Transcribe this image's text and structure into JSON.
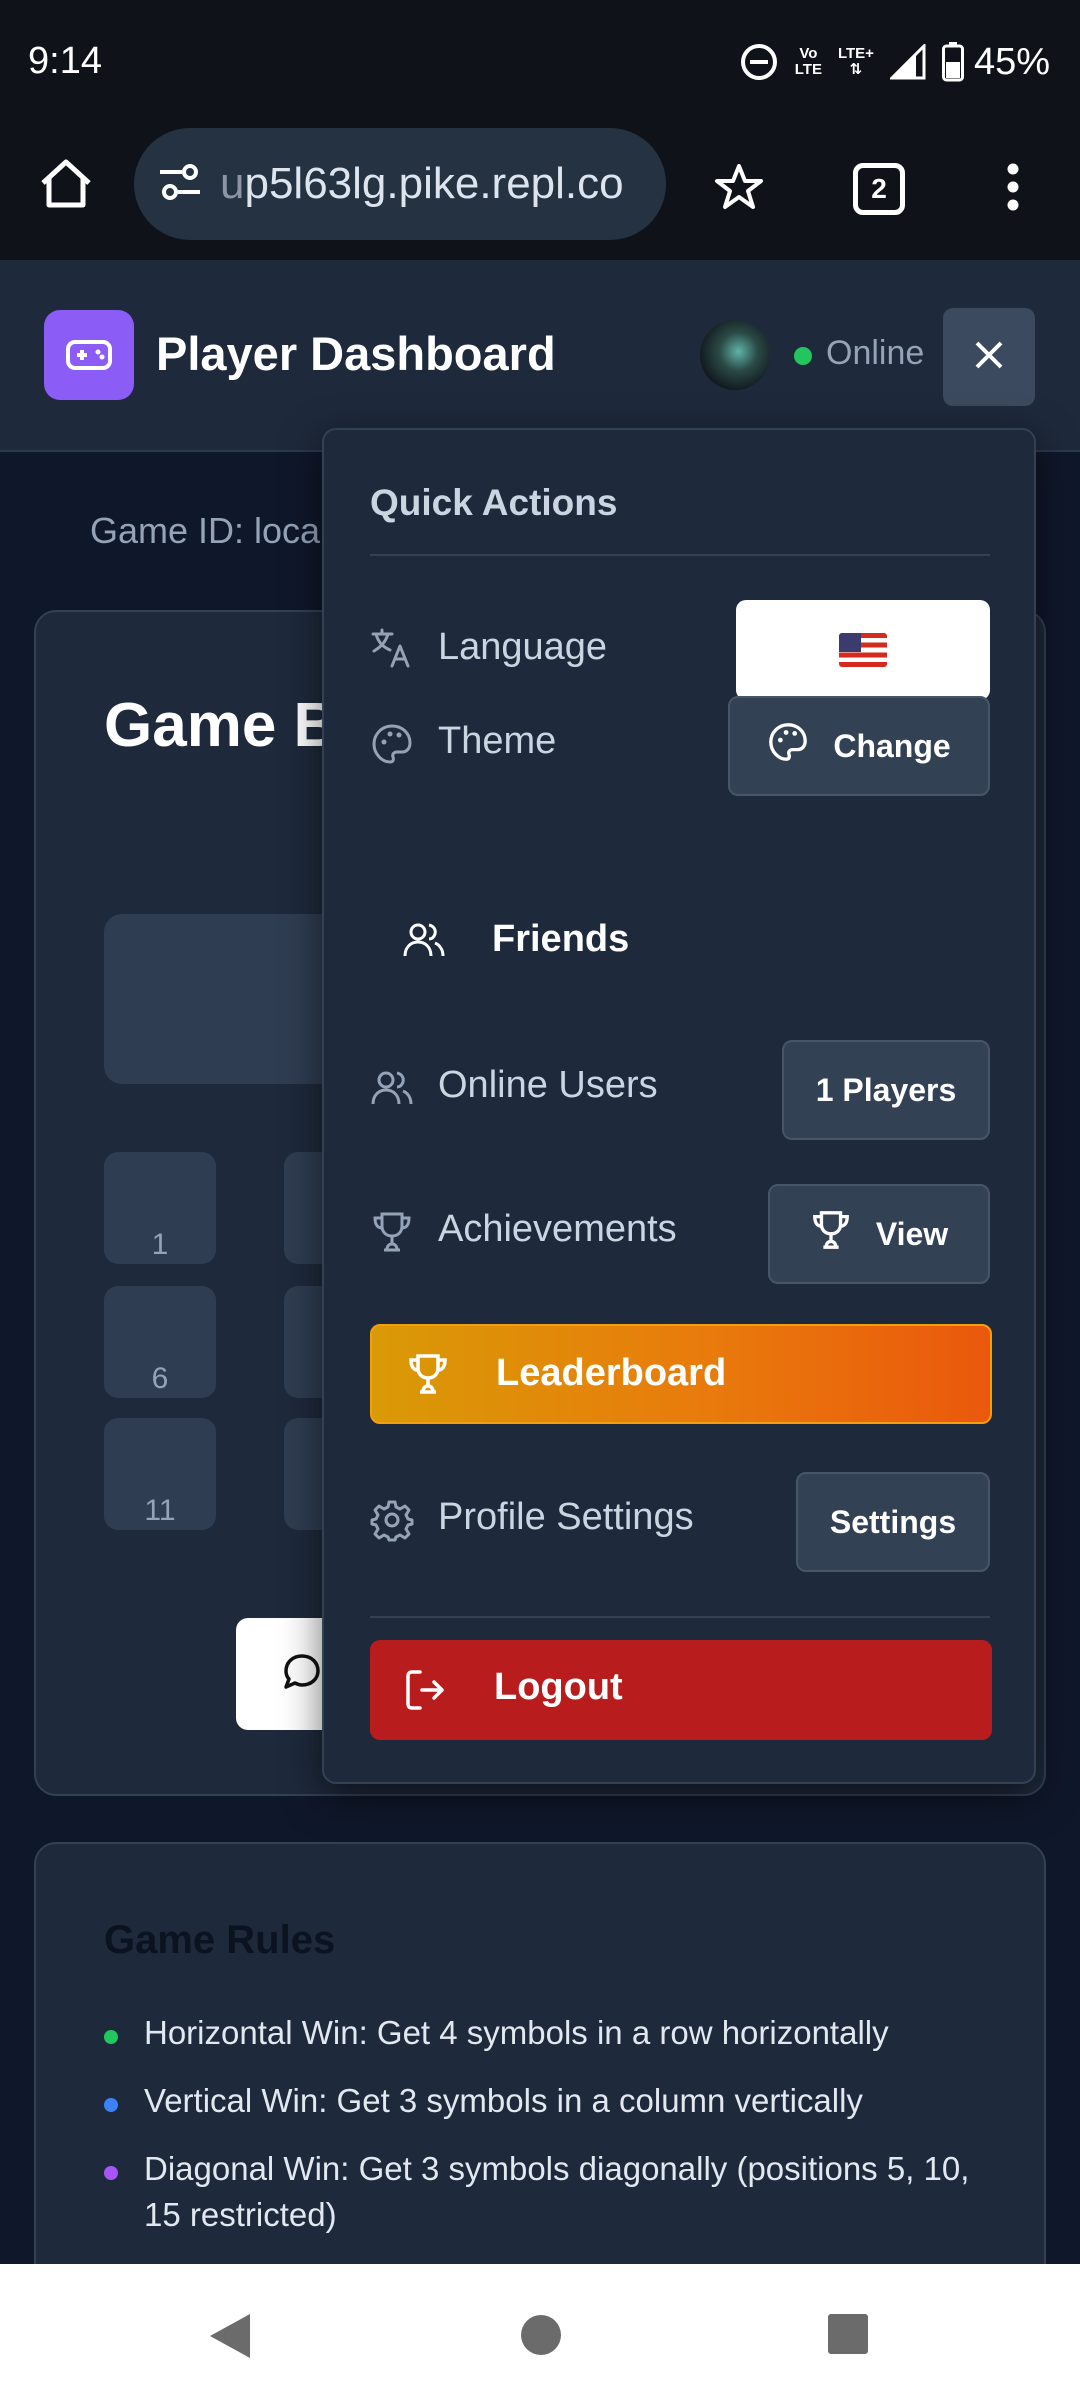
{
  "status_bar": {
    "time": "9:14",
    "network_label_top": "Vo",
    "network_label_bottom": "LTE",
    "lte_label": "LTE+",
    "battery": "45%",
    "icons": [
      "do-not-disturb-icon",
      "volte-icon",
      "lte-plus-icon",
      "signal-icon",
      "battery-icon"
    ]
  },
  "browser": {
    "url_prefix": "u",
    "url_main": "p5l63lg.pike.repl.co",
    "tab_count": "2",
    "icons": [
      "home-icon",
      "site-settings-icon",
      "bookmark-star-icon",
      "tabs-icon",
      "more-menu-icon"
    ]
  },
  "header": {
    "title": "Player Dashboard",
    "status": "Online",
    "colors": {
      "logo": "#8b5cf6",
      "online": "#22c55e",
      "background": "#1e293b"
    }
  },
  "page": {
    "game_id": "Game ID: loca",
    "board_title": "Game B",
    "cells": [
      "1",
      "6",
      "11"
    ]
  },
  "rules": {
    "title": "Game Rules",
    "items": [
      {
        "text": "Horizontal Win: Get 4 symbols in a row horizontally",
        "color": "#22c55e"
      },
      {
        "text": "Vertical Win: Get 3 symbols in a column vertically",
        "color": "#3b82f6"
      },
      {
        "text": "Diagonal Win: Get 3 symbols diagonally (positions 5, 10, 15 restricted)",
        "color": "#a855f7"
      }
    ]
  },
  "menu": {
    "title": "Quick Actions",
    "language": {
      "label": "Language",
      "flag": "US flag"
    },
    "theme": {
      "label": "Theme",
      "button": "Change"
    },
    "friends": {
      "label": "Friends"
    },
    "online_users": {
      "label": "Online Users",
      "button": "1 Players"
    },
    "achievements": {
      "label": "Achievements",
      "button": "View"
    },
    "leaderboard": {
      "label": "Leaderboard"
    },
    "profile_settings": {
      "label": "Profile Settings",
      "button": "Settings"
    },
    "logout": {
      "label": "Logout"
    },
    "colors": {
      "leaderboard_start": "#d99a06",
      "leaderboard_end": "#ea580c",
      "logout": "#b91c1c"
    }
  }
}
